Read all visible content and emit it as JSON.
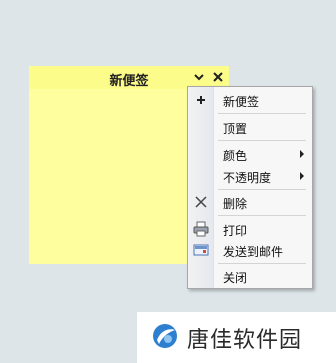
{
  "note": {
    "title": "新便签",
    "dropdown_icon": "chevron-down-icon",
    "close_icon": "close-icon",
    "color": "#fefe9e"
  },
  "menu": {
    "items": [
      {
        "label": "新便签",
        "icon": "plus-icon",
        "submenu": false
      },
      {
        "label": "顶置",
        "icon": null,
        "submenu": false
      },
      {
        "label": "颜色",
        "icon": null,
        "submenu": true
      },
      {
        "label": "不透明度",
        "icon": null,
        "submenu": true
      },
      {
        "label": "删除",
        "icon": "delete-x-icon",
        "submenu": false
      },
      {
        "label": "打印",
        "icon": "printer-icon",
        "submenu": false
      },
      {
        "label": "发送到邮件",
        "icon": "mail-icon",
        "submenu": false
      },
      {
        "label": "关闭",
        "icon": null,
        "submenu": false
      }
    ]
  },
  "watermark": {
    "text": "唐佳软件园"
  }
}
